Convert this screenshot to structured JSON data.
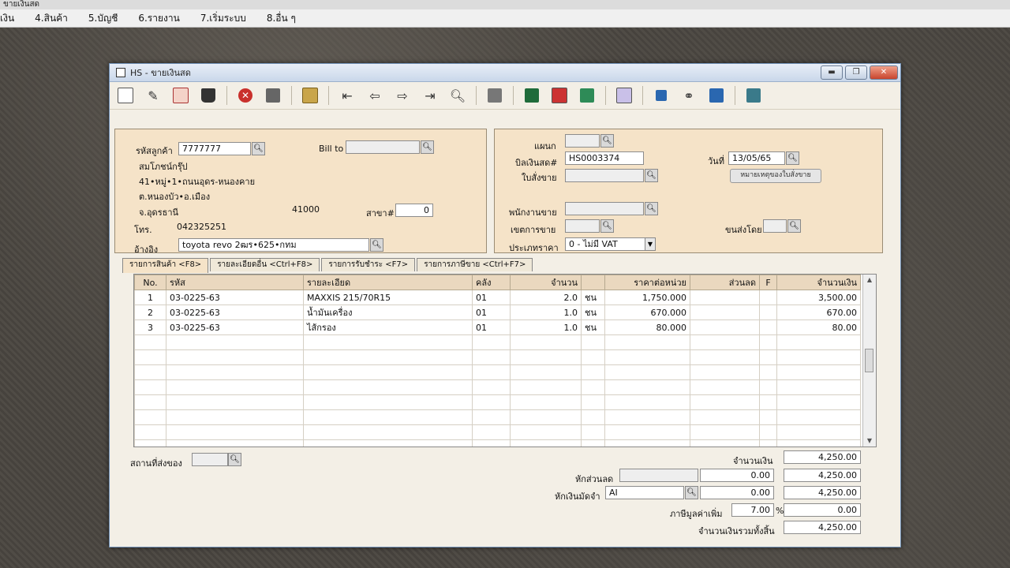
{
  "app": {
    "title": "ขายเงินสด",
    "menu": [
      "เงิน",
      "4.สินค้า",
      "5.บัญชี",
      "6.รายงาน",
      "7.เริ่มระบบ",
      "8.อื่น ๆ"
    ]
  },
  "window": {
    "title": "HS - ขายเงินสด",
    "minimize": "▬",
    "maximize": "❐",
    "close": "✕"
  },
  "toolbar": {
    "icons": [
      "new-icon",
      "edit-icon",
      "copy-icon",
      "trash-icon",
      "cancel-icon",
      "save-icon",
      "stack-icon",
      "first-record-icon",
      "prev-record-icon",
      "next-record-icon",
      "last-record-icon",
      "search-icon",
      "print-icon",
      "excel-icon",
      "pdf-icon",
      "chart-icon",
      "calendar-icon",
      "approve-icon",
      "link-icon",
      "ok-icon",
      "settings-icon"
    ]
  },
  "customer": {
    "code_label": "รหัสลูกค้า",
    "code": "7777777",
    "billto_label": "Bill to",
    "billto": "",
    "name": "สมโภชน์กรุ๊ป",
    "address1": "41•หมู่•1•ถนนอุดร-หนองคาย",
    "address2": "ต.หนองบัว•อ.เมือง",
    "province": "จ.อุดรธานี",
    "postcode": "41000",
    "branch_label": "สาขา#",
    "branch": "0",
    "phone_label": "โทร.",
    "phone": "042325251",
    "ref_label": "อ้างอิง",
    "ref": "toyota revo 2ฒร•625•กทม"
  },
  "invoice": {
    "dept_label": "แผนก",
    "dept": "",
    "bill_label": "บิลเงินสด#",
    "bill_no": "HS0003374",
    "date_label": "วันที่",
    "date": "13/05/65",
    "order_label": "ใบสั่งขาย",
    "order": "",
    "order_note_button": "หมายเหตุของใบสั่งขาย",
    "salesman_label": "พนักงานขาย",
    "salesman": "",
    "zone_label": "เขตการขาย",
    "zone": "",
    "ship_label": "ขนส่งโดย",
    "ship": "",
    "price_type_label": "ประเภทราคา",
    "price_type": "0 - ไม่มี VAT"
  },
  "tabs": [
    "รายการสินค้า <F8>",
    "รายละเอียดอื่น <Ctrl+F8>",
    "รายการรับชำระ <F7>",
    "รายการภาษีขาย <Ctrl+F7>"
  ],
  "grid": {
    "headers": [
      "No.",
      "รหัส",
      "รายละเอียด",
      "คลัง",
      "จำนวน",
      "",
      "ราคาต่อหน่วย",
      "ส่วนลด",
      "F",
      "จำนวนเงิน"
    ],
    "rows": [
      [
        "1",
        "03-0225-63",
        "MAXXIS 215/70R15",
        "01",
        "2.0",
        "ชน",
        "1,750.000",
        "",
        "",
        "3,500.00"
      ],
      [
        "2",
        "03-0225-63",
        "น้ำมันเครื่อง",
        "01",
        "1.0",
        "ชน",
        "670.000",
        "",
        "",
        "670.00"
      ],
      [
        "3",
        "03-0225-63",
        "ไส้กรอง",
        "01",
        "1.0",
        "ชน",
        "80.000",
        "",
        "",
        "80.00"
      ]
    ]
  },
  "footer": {
    "delivery_label": "สถานที่ส่งของ",
    "delivery": "",
    "amount_label": "จำนวนเงิน",
    "amount": "4,250.00",
    "discount_label": "หักส่วนลด",
    "discount_text": "",
    "discount_value": "0.00",
    "after_discount": "4,250.00",
    "deposit_label": "หักเงินมัดจำ",
    "deposit_code": "AI",
    "deposit_value": "0.00",
    "after_deposit": "4,250.00",
    "vat_label": "ภาษีมูลค่าเพิ่ม",
    "vat_rate": "7.00",
    "vat_unit": "%",
    "vat_value": "0.00",
    "total_label": "จำนวนเงินรวมทั้งสิ้น",
    "total": "4,250.00"
  }
}
